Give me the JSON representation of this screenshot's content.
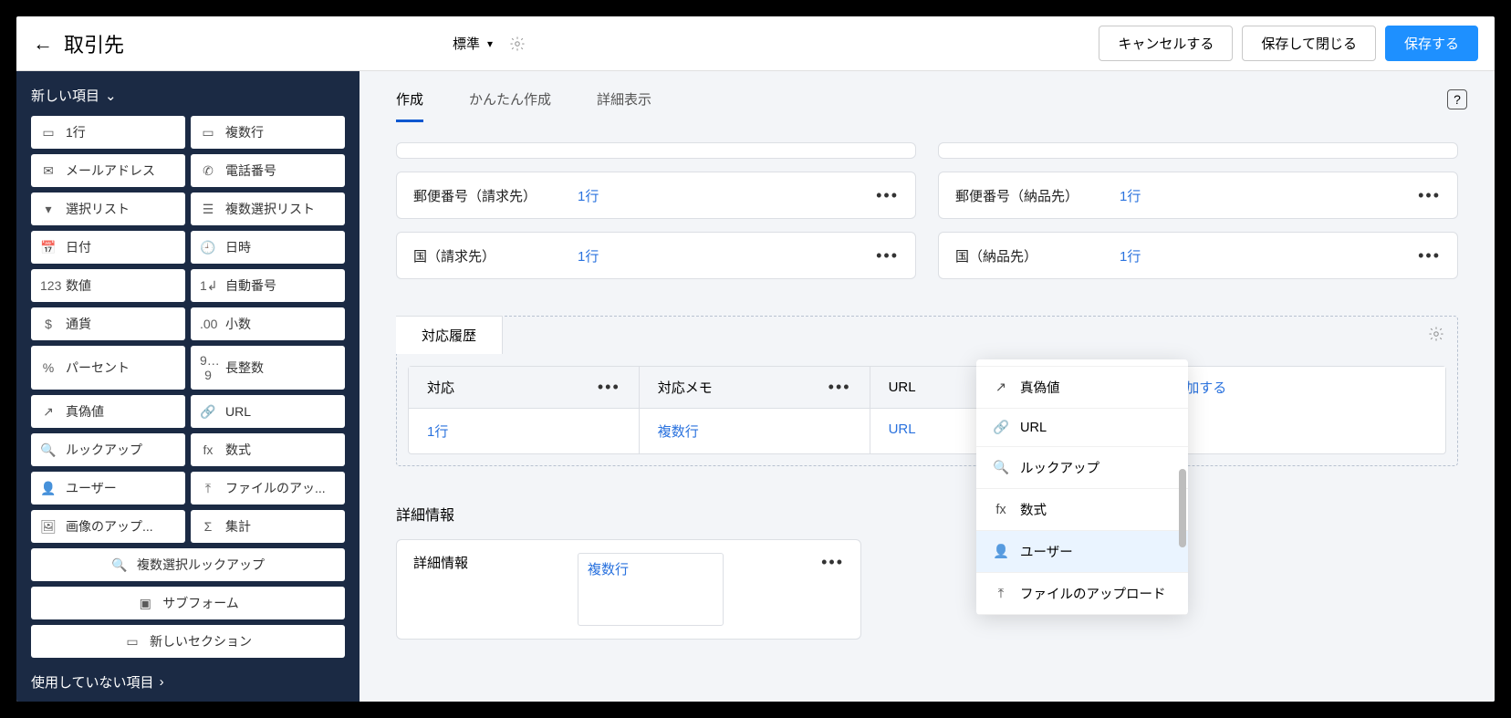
{
  "header": {
    "title": "取引先",
    "layout_dropdown": "標準",
    "cancel": "キャンセルする",
    "save_close": "保存して閉じる",
    "save": "保存する"
  },
  "sidebar": {
    "new_fields_header": "新しい項目",
    "fields": [
      {
        "label": "1行",
        "icon": "▭"
      },
      {
        "label": "複数行",
        "icon": "▭"
      },
      {
        "label": "メールアドレス",
        "icon": "✉"
      },
      {
        "label": "電話番号",
        "icon": "✆"
      },
      {
        "label": "選択リスト",
        "icon": "▾"
      },
      {
        "label": "複数選択リスト",
        "icon": "☰"
      },
      {
        "label": "日付",
        "icon": "📅"
      },
      {
        "label": "日時",
        "icon": "🕘"
      },
      {
        "label": "数値",
        "icon": "123"
      },
      {
        "label": "自動番号",
        "icon": "1↲"
      },
      {
        "label": "通貨",
        "icon": "$"
      },
      {
        "label": "小数",
        "icon": ".00"
      },
      {
        "label": "パーセント",
        "icon": "%"
      },
      {
        "label": "長整数",
        "icon": "9…9"
      },
      {
        "label": "真偽値",
        "icon": "↗"
      },
      {
        "label": "URL",
        "icon": "🔗"
      },
      {
        "label": "ルックアップ",
        "icon": "🔍"
      },
      {
        "label": "数式",
        "icon": "fx"
      },
      {
        "label": "ユーザー",
        "icon": "👤"
      },
      {
        "label": "ファイルのアッ...",
        "icon": "⤒"
      },
      {
        "label": "画像のアップ...",
        "icon": "🖼"
      },
      {
        "label": "集計",
        "icon": "Σ"
      }
    ],
    "wide_fields": [
      {
        "label": "複数選択ルックアップ",
        "icon": "🔍"
      },
      {
        "label": "サブフォーム",
        "icon": "▣"
      },
      {
        "label": "新しいセクション",
        "icon": "▭"
      }
    ],
    "unused": "使用していない項目"
  },
  "tabs": [
    "作成",
    "かんたん作成",
    "詳細表示"
  ],
  "form_fields": [
    {
      "left": {
        "name": "郵便番号（請求先）",
        "type": "1行"
      },
      "right": {
        "name": "郵便番号（納品先）",
        "type": "1行"
      }
    },
    {
      "left": {
        "name": "国（請求先）",
        "type": "1行"
      },
      "right": {
        "name": "国（納品先）",
        "type": "1行"
      }
    }
  ],
  "subform_section": {
    "title": "対応履歴",
    "columns": [
      {
        "head": "対応",
        "body": "1行"
      },
      {
        "head": "対応メモ",
        "body": "複数行"
      },
      {
        "head": "URL",
        "body": "URL"
      }
    ],
    "add_label": "+ 項目を追加する"
  },
  "details_section": {
    "title": "詳細情報",
    "field_name": "詳細情報",
    "field_type": "複数行"
  },
  "popup_items": [
    {
      "label": "真偽値",
      "icon": "↗",
      "highlight": false
    },
    {
      "label": "URL",
      "icon": "🔗",
      "highlight": false
    },
    {
      "label": "ルックアップ",
      "icon": "🔍",
      "highlight": false
    },
    {
      "label": "数式",
      "icon": "fx",
      "highlight": false
    },
    {
      "label": "ユーザー",
      "icon": "👤",
      "highlight": true
    },
    {
      "label": "ファイルのアップロード",
      "icon": "⤒",
      "highlight": false
    }
  ]
}
